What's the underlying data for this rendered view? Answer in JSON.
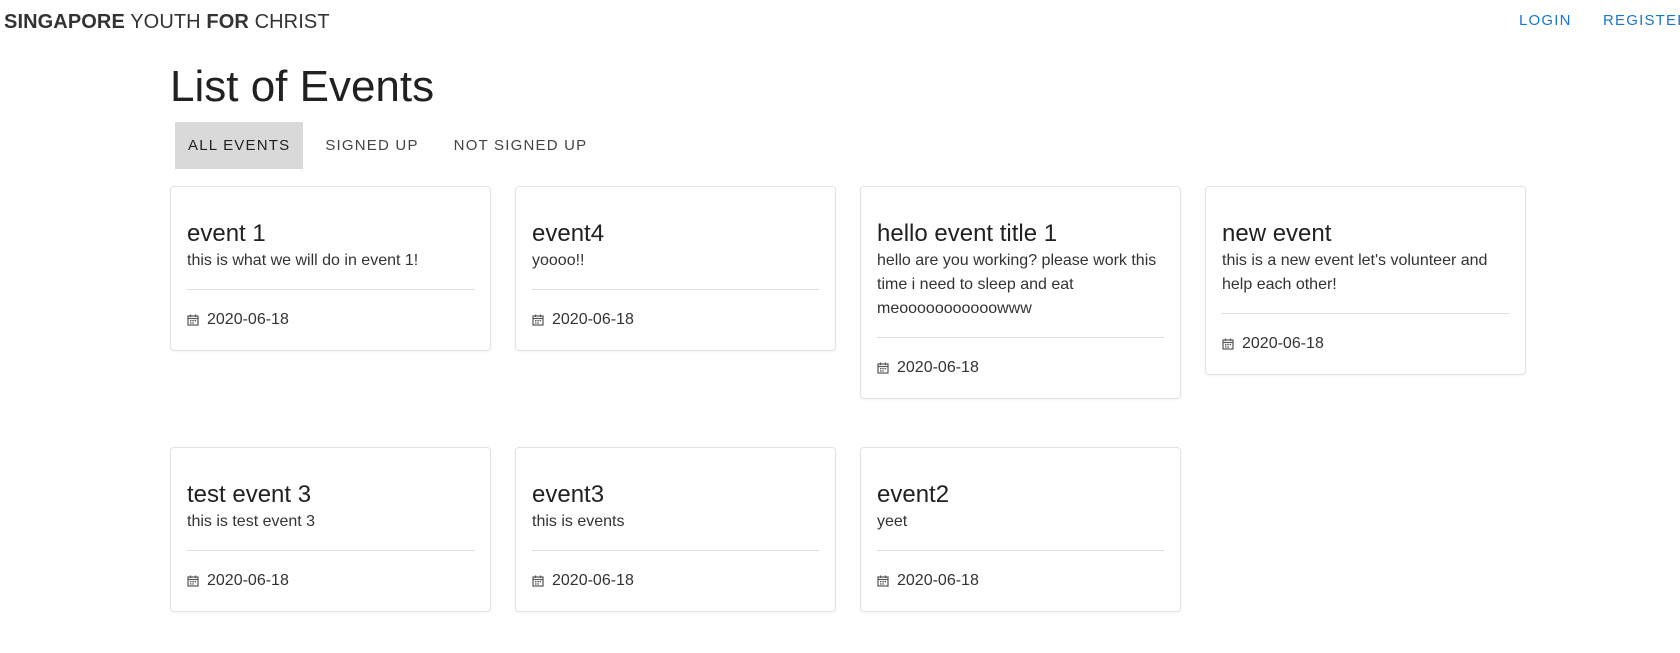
{
  "header": {
    "brand": {
      "part1": "SINGAPORE",
      "part2": "YOUTH",
      "part3": "FOR",
      "part4": "CHRIST"
    },
    "login_label": "LOGIN",
    "register_label": "REGISTER"
  },
  "main": {
    "title": "List of Events",
    "tabs": [
      {
        "label": "ALL EVENTS",
        "active": true
      },
      {
        "label": "SIGNED UP",
        "active": false
      },
      {
        "label": "NOT SIGNED UP",
        "active": false
      }
    ],
    "events": [
      {
        "title": "event 1",
        "description": "this is what we will do in event 1!",
        "date": "2020-06-18"
      },
      {
        "title": "event4",
        "description": "yoooo!!",
        "date": "2020-06-18"
      },
      {
        "title": "hello event title 1",
        "description": "hello are you working? please work this time i need to sleep and eat meooooooooooowww",
        "date": "2020-06-18"
      },
      {
        "title": "new event",
        "description": "this is a new event let's volunteer and help each other!",
        "date": "2020-06-18"
      },
      {
        "title": "test event 3",
        "description": "this is test event 3",
        "date": "2020-06-18"
      },
      {
        "title": "event3",
        "description": "this is events",
        "date": "2020-06-18"
      },
      {
        "title": "event2",
        "description": "yeet",
        "date": "2020-06-18"
      }
    ]
  },
  "icons": {
    "date": "calendar-icon"
  },
  "colors": {
    "accent": "#1976d2",
    "active_tab_bg": "#d9d9d9"
  }
}
